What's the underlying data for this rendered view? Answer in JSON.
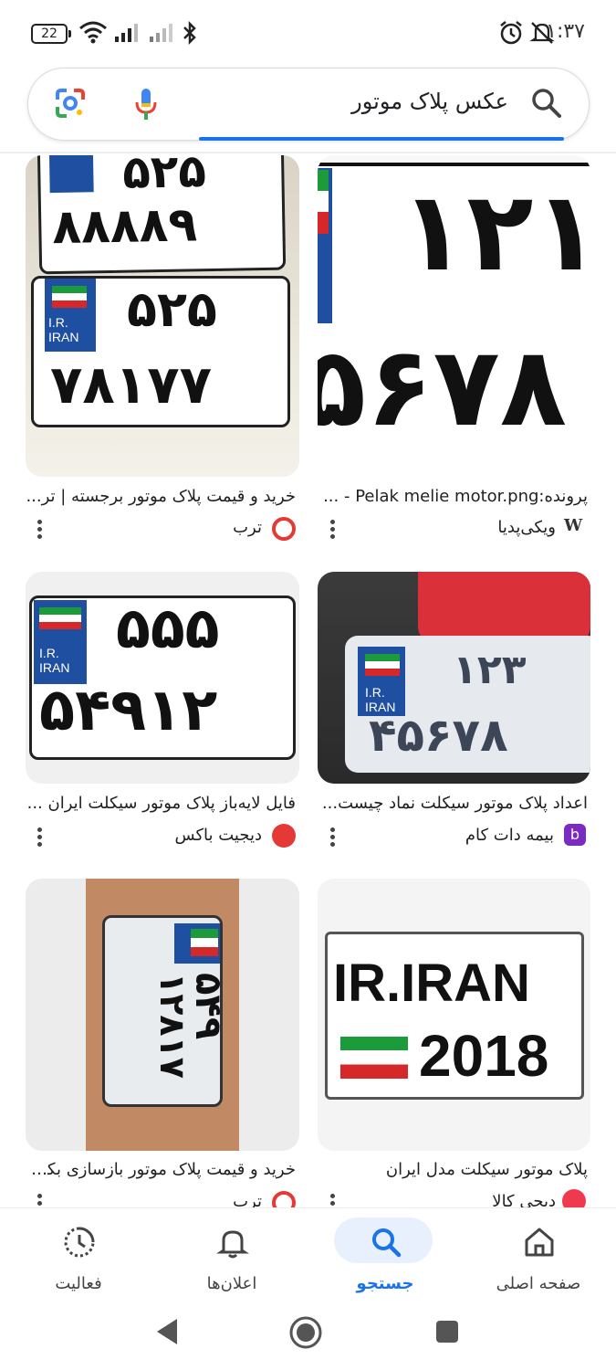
{
  "status": {
    "battery": "22",
    "time": "۱:۳۷"
  },
  "search": {
    "query": "عکس پلاک موتور"
  },
  "results": [
    {
      "title": "خرید و قیمت پلاک موتور برجسته | تر...",
      "source": "ترب",
      "plate_top": "۵۲۵",
      "plate_top2": "۸۸۸۸۹",
      "plate_bottom": "۵۲۵",
      "plate_bottom2": "۷۸۱۷۷",
      "iran": "I.R.\nIRAN"
    },
    {
      "title": "پرونده:Pelak melie motor.png - ...",
      "source": "ویکی‌پدیا",
      "favicon": "W",
      "plate_top": "۱۲۱",
      "plate_bottom": "۵۶۷۸"
    },
    {
      "title": "فایل لایه‌باز پلاک موتور سیکلت ایران ...",
      "source": "دیجیت باکس",
      "plate_top": "۵۵۵",
      "plate_bottom": "۵۴۹۱۲",
      "iran": "I.R.\nIRAN"
    },
    {
      "title": "اعداد پلاک موتور سیکلت نماد چیست...",
      "source": "بیمه دات کام",
      "favicon": "b",
      "plate_top": "۱۲۳",
      "plate_bottom": "۴۵۶۷۸",
      "iran": "I.R.\nIRAN"
    },
    {
      "title": "خرید و قیمت پلاک موتور بازسازی بکی...",
      "source": "ترب",
      "plate_top": "۵۴۹",
      "plate_bottom": "۱۲۸۱۷",
      "iran": "I.R.\nIRAN"
    },
    {
      "title": "پلاک موتور سیکلت مدل ایران",
      "source": "دیجی کالا",
      "plate_top": "IR.IRAN",
      "plate_bottom": "2018"
    }
  ],
  "bottom_nav": [
    {
      "label": "فعالیت",
      "icon": "activity-icon"
    },
    {
      "label": "اعلان‌ها",
      "icon": "bell-icon"
    },
    {
      "label": "جستجو",
      "icon": "search-icon",
      "active": true
    },
    {
      "label": "صفحه اصلی",
      "icon": "home-icon"
    }
  ],
  "colors": {
    "accent": "#1a73e8",
    "nav_active_bg": "#e8f0fe",
    "torob": "#e53935",
    "digikala": "#ef394e",
    "bimeh": "#7b2cbf"
  }
}
